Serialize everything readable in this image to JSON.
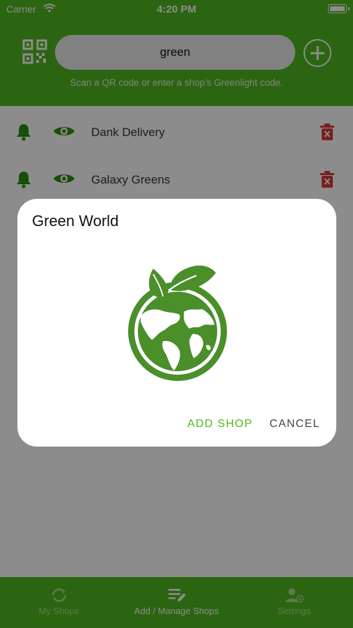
{
  "status_bar": {
    "carrier": "Carrier",
    "time": "4:20 PM"
  },
  "header": {
    "search_value": "green",
    "hint": "Scan a QR code or enter a shop's Greenlight code.",
    "qr_icon": "qr-code-icon",
    "add_icon": "plus-circle-icon"
  },
  "shops": [
    {
      "name": "Dank Delivery"
    },
    {
      "name": "Galaxy Greens"
    }
  ],
  "dialog": {
    "title": "Green World",
    "add_label": "ADD SHOP",
    "cancel_label": "CANCEL"
  },
  "tabs": [
    {
      "label": "My Shops",
      "icon": "refresh-icon",
      "active": false
    },
    {
      "label": "Add / Manage Shops",
      "icon": "edit-list-icon",
      "active": true
    },
    {
      "label": "Settings",
      "icon": "user-settings-icon",
      "active": false
    }
  ],
  "colors": {
    "brand_green": "#4fb81f",
    "icon_green": "#2f8f12",
    "delete_red": "#d93b3b",
    "logo_green": "#4a8f2a"
  }
}
